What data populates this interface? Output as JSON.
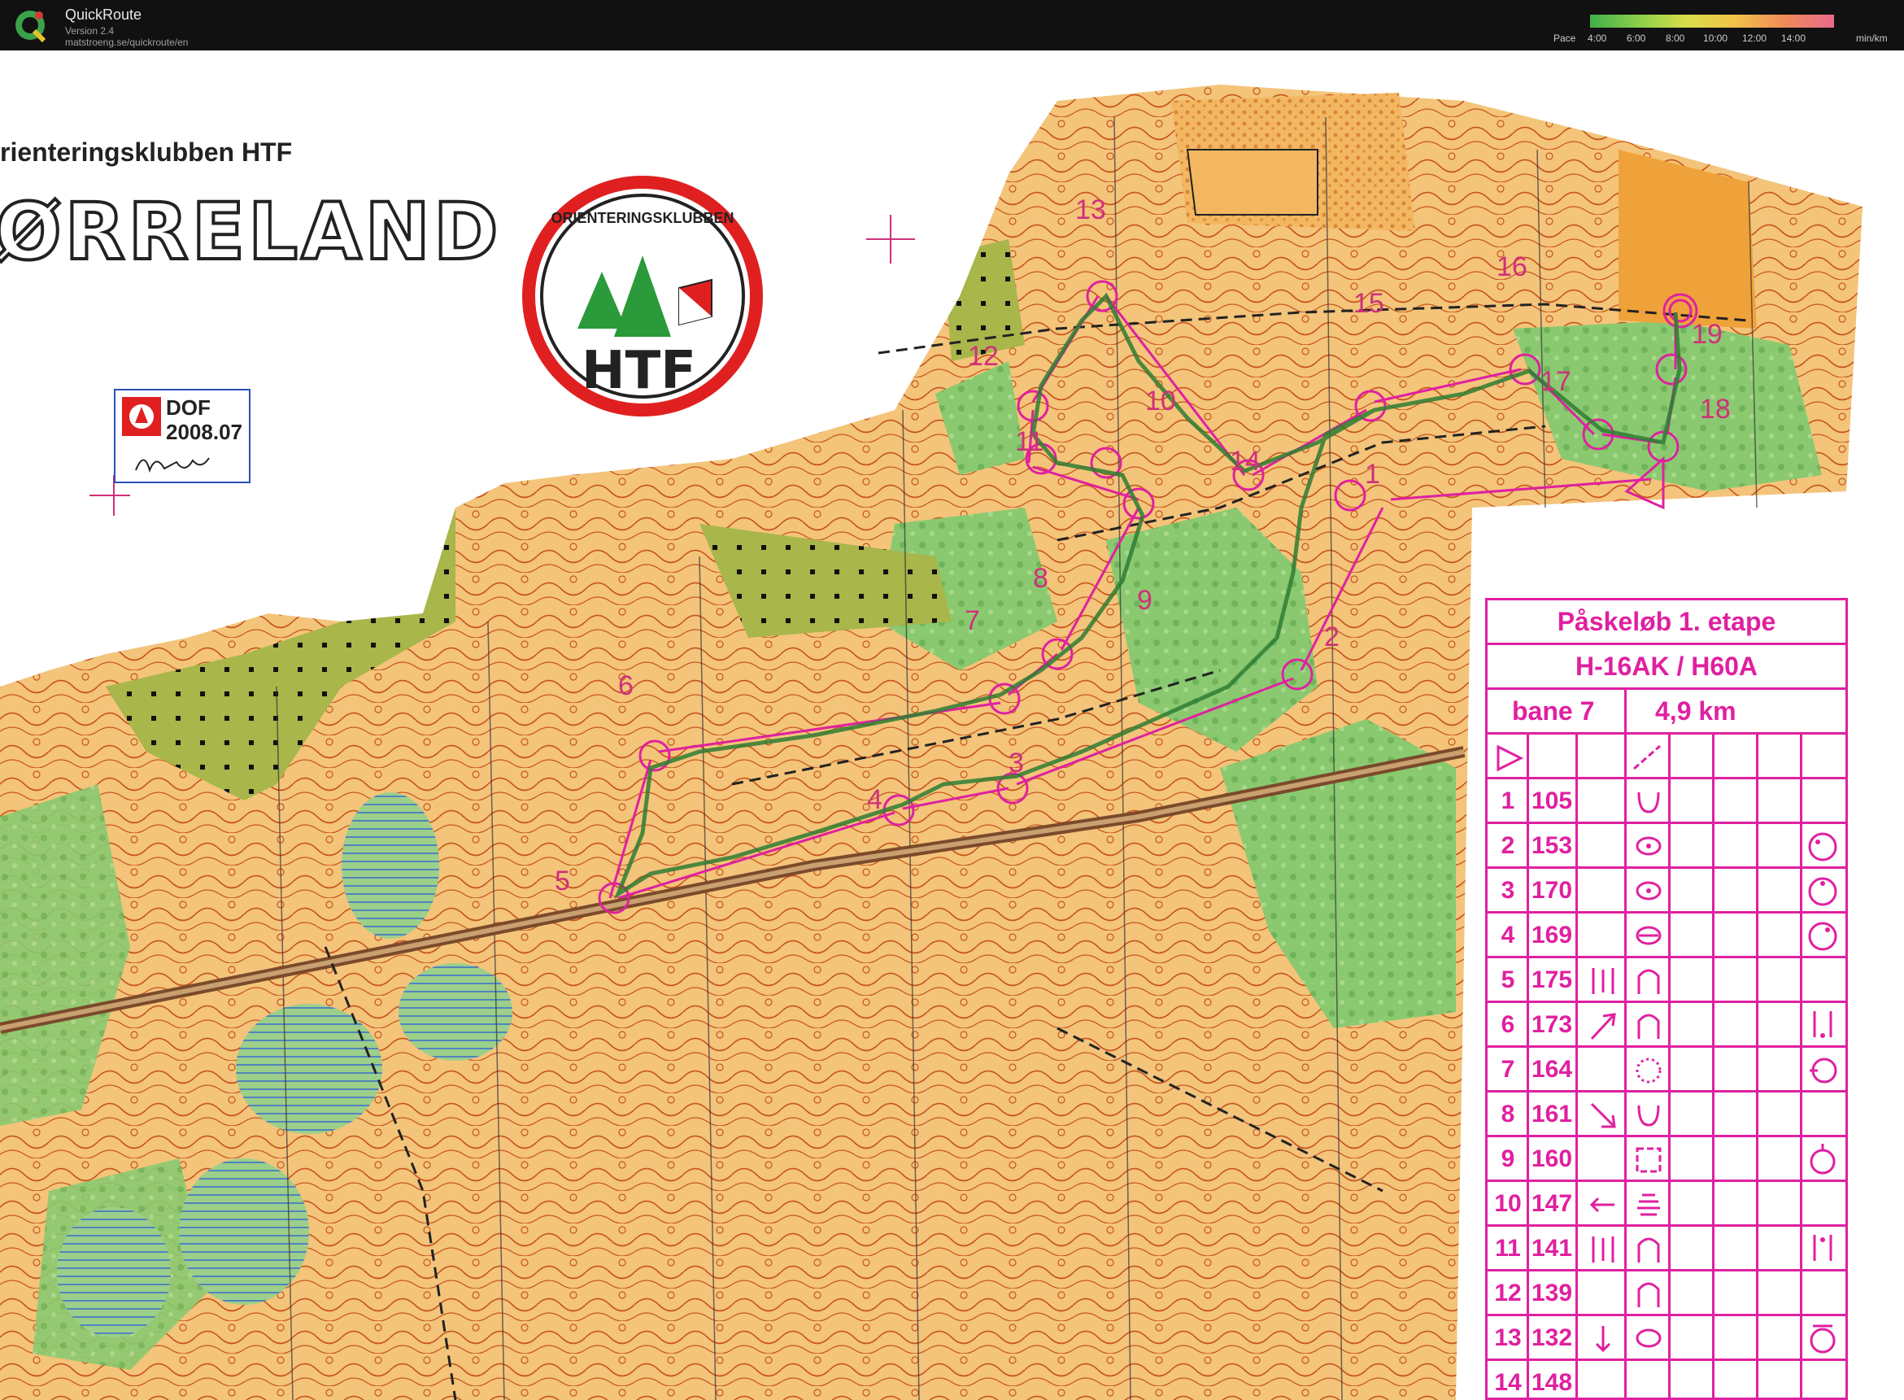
{
  "app": {
    "name": "QuickRoute",
    "version": "Version 2.4",
    "url": "matstroeng.se/quickroute/en",
    "pace_legend": {
      "label": "Pace",
      "ticks": [
        "4:00",
        "6:00",
        "8:00",
        "10:00",
        "12:00",
        "14:00"
      ],
      "unit": "min/km",
      "colors": [
        "#3fb04a",
        "#8ccf4a",
        "#d9de4a",
        "#f1c14a",
        "#f08a5a",
        "#e86a8a"
      ]
    }
  },
  "map": {
    "club_title": "rienteringsklubben HTF",
    "map_name": "ØRRELAND",
    "club_logo": {
      "ring_text": "ORIENTERINGSKLUBBEN",
      "abbr": "HTF"
    },
    "stamp": {
      "org": "DOF",
      "code": "2008.07"
    },
    "controls": [
      "1",
      "2",
      "3",
      "4",
      "5",
      "6",
      "7",
      "8",
      "9",
      "10",
      "11",
      "12",
      "13",
      "14",
      "15",
      "16",
      "17",
      "18",
      "19"
    ],
    "colors": {
      "course": "#e020a0",
      "route": "#2e7d32",
      "open_land": "#f2b760",
      "forest_green": "#8ac970",
      "contour": "#c8541c"
    }
  },
  "control_card": {
    "title": "Påskeløb 1. etape",
    "class": "H-16AK / H60A",
    "course": "bane 7",
    "length": "4,9 km",
    "legs": [
      {
        "num": "1",
        "code": "105"
      },
      {
        "num": "2",
        "code": "153"
      },
      {
        "num": "3",
        "code": "170"
      },
      {
        "num": "4",
        "code": "169"
      },
      {
        "num": "5",
        "code": "175"
      },
      {
        "num": "6",
        "code": "173"
      },
      {
        "num": "7",
        "code": "164"
      },
      {
        "num": "8",
        "code": "161"
      },
      {
        "num": "9",
        "code": "160"
      },
      {
        "num": "10",
        "code": "147"
      },
      {
        "num": "11",
        "code": "141"
      },
      {
        "num": "12",
        "code": "139"
      },
      {
        "num": "13",
        "code": "132"
      },
      {
        "num": "14",
        "code": "148"
      }
    ]
  }
}
